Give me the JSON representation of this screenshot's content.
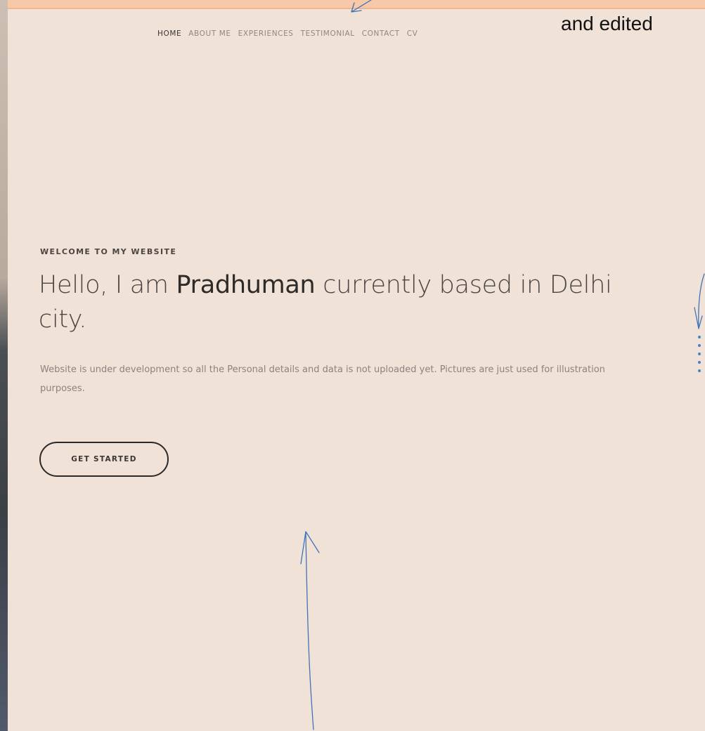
{
  "nav": {
    "items": [
      {
        "label": "HOME",
        "active": true
      },
      {
        "label": "ABOUT ME",
        "active": false
      },
      {
        "label": "EXPERIENCES",
        "active": false
      },
      {
        "label": "TESTIMONIAL",
        "active": false
      },
      {
        "label": "CONTACT",
        "active": false
      },
      {
        "label": "CV",
        "active": false
      }
    ]
  },
  "overlay": {
    "caption": "and edited"
  },
  "hero": {
    "eyebrow": "WELCOME TO MY WEBSITE",
    "headline_pre": "Hello, I am ",
    "headline_name": "Pradhuman",
    "headline_post": " currently based in Delhi city.",
    "description": "Website is under development so all the Personal details and data is not uploaded yet. Pictures are just used for illustration purposes.",
    "cta_label": "GET STARTED"
  },
  "slider": {
    "dot_count": 5
  },
  "colors": {
    "background": "#f1e2d8",
    "top_strip": "#f7c9a8",
    "annotation_blue": "#3f73b8",
    "dot_blue": "#4a7fd0"
  }
}
